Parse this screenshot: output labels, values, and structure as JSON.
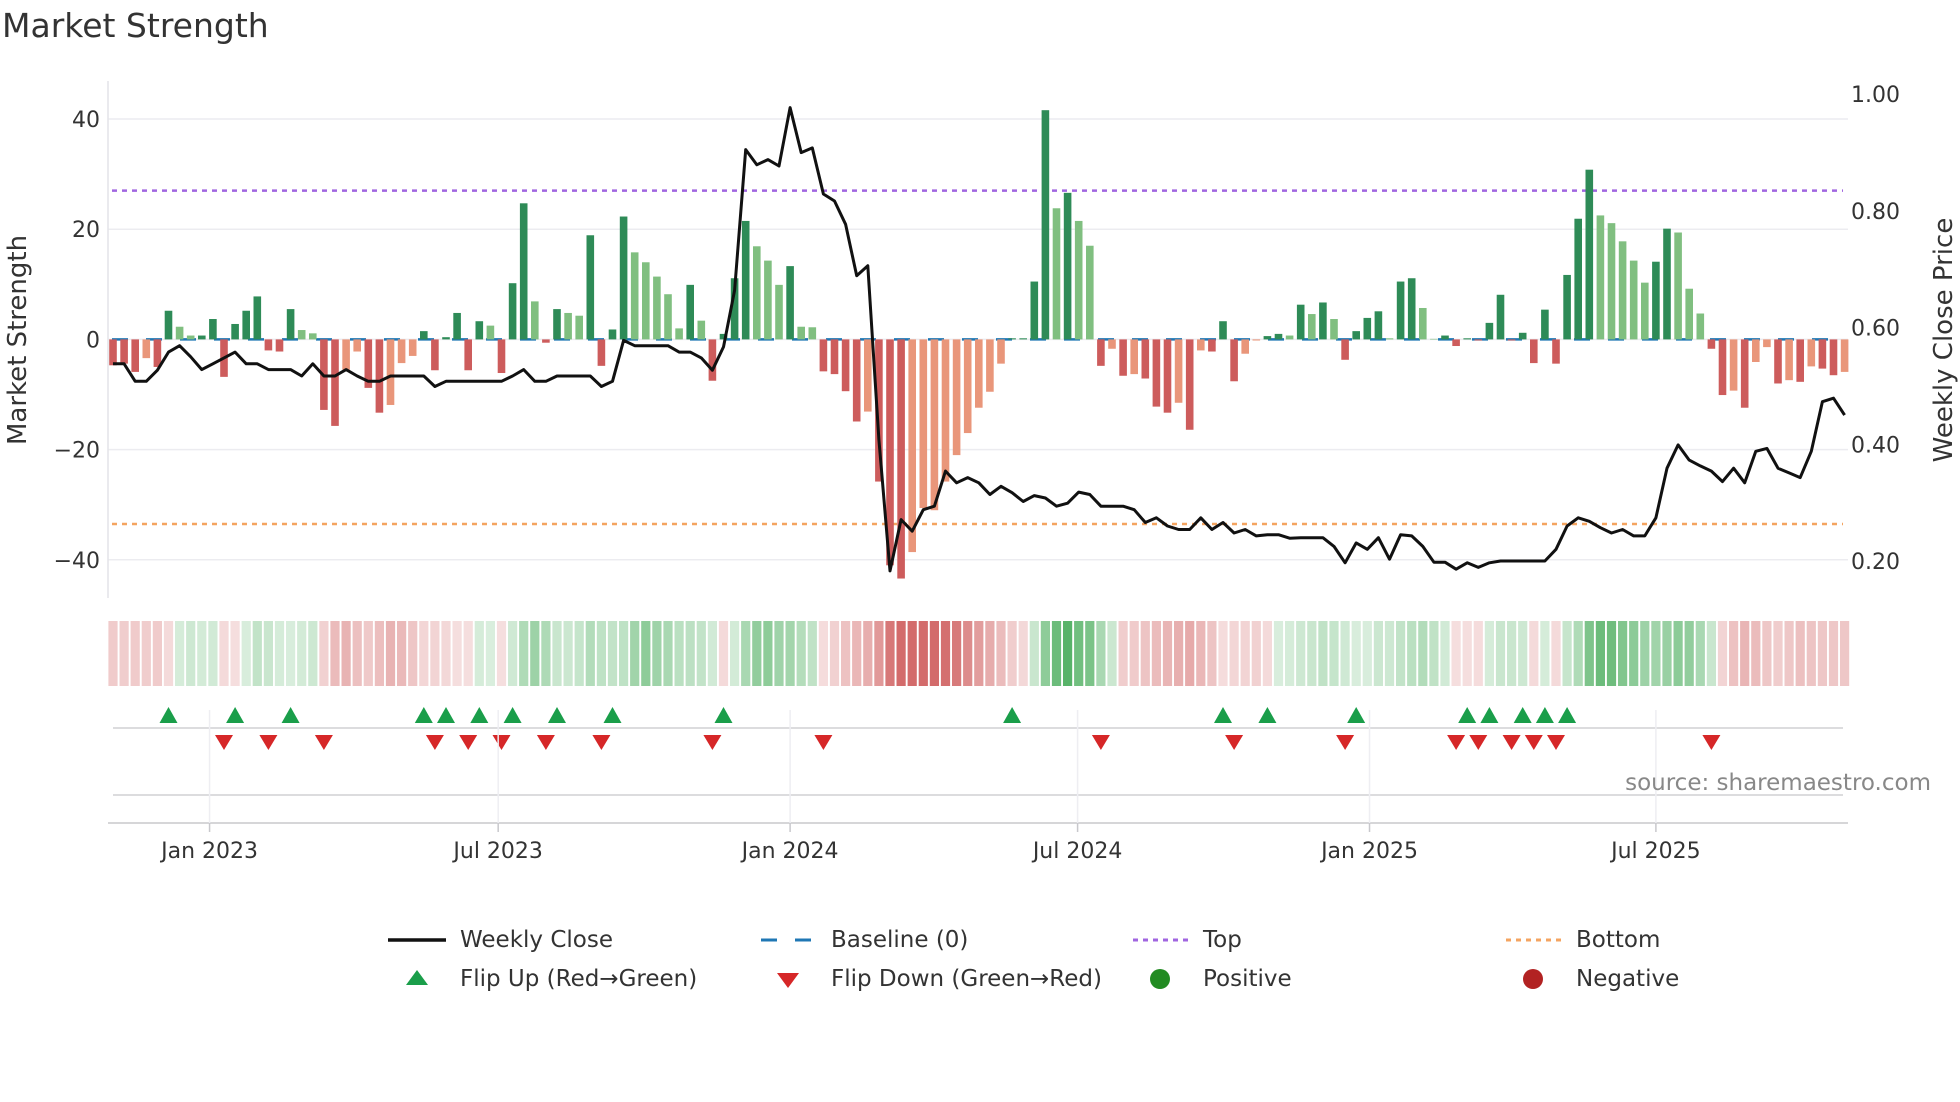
{
  "title": "Market Strength",
  "source": "source: sharemaestro.com",
  "colors": {
    "strong_positive": "#2e8b57",
    "weak_positive": "#80bf80",
    "strong_negative": "#cd5c5c",
    "weak_negative": "#e9967a",
    "price_line": "#111111",
    "baseline": "#1f77b4",
    "top": "#a066e0",
    "bottom": "#f4a460",
    "flip_up": "#1a9e4a",
    "flip_down": "#d62728",
    "positive": "#228b22",
    "negative": "#b22222"
  },
  "legend": [
    {
      "key": "weekly_close",
      "label": "Weekly Close"
    },
    {
      "key": "baseline",
      "label": "Baseline (0)"
    },
    {
      "key": "top",
      "label": "Top"
    },
    {
      "key": "bottom",
      "label": "Bottom"
    },
    {
      "key": "flip_up",
      "label": "Flip Up (Red→Green)"
    },
    {
      "key": "flip_down",
      "label": "Flip Down (Green→Red)"
    },
    {
      "key": "positive",
      "label": "Positive"
    },
    {
      "key": "negative",
      "label": "Negative"
    }
  ],
  "chart_data": {
    "type": "bar",
    "title": "Market Strength",
    "frequency": "weekly",
    "ylabel": "Market Strength",
    "ylabel_right": "Weekly Close Price",
    "ylim": [
      -47,
      49
    ],
    "ylim_right": [
      0.2,
      1.0
    ],
    "yticks": [
      {
        "v": 40,
        "label": "40"
      },
      {
        "v": 20,
        "label": "20"
      },
      {
        "v": 0,
        "label": "0"
      },
      {
        "v": -20,
        "label": "−20"
      },
      {
        "v": -40,
        "label": "−40"
      }
    ],
    "yticks_right": [
      {
        "v": 1.0,
        "label": "1.00"
      },
      {
        "v": 0.8,
        "label": "0.80"
      },
      {
        "v": 0.6,
        "label": "0.60"
      },
      {
        "v": 0.4,
        "label": "0.40"
      },
      {
        "v": 0.2,
        "label": "0.20"
      }
    ],
    "xticks": [
      {
        "week": 8.7,
        "label": "Jan 2023"
      },
      {
        "week": 34.7,
        "label": "Jul 2023"
      },
      {
        "week": 61.0,
        "label": "Jan 2024"
      },
      {
        "week": 86.9,
        "label": "Jul 2024"
      },
      {
        "week": 113.2,
        "label": "Jan 2025"
      },
      {
        "week": 139.0,
        "label": "Jul 2025"
      }
    ],
    "top_level": 27,
    "bottom_level": -33.5,
    "baseline": 0,
    "strength": [
      -4.7,
      -4.4,
      -5.9,
      -3.4,
      -5,
      5.2,
      2.3,
      0.7,
      0.7,
      3.7,
      -6.8,
      2.8,
      5.2,
      7.8,
      -2,
      -2.2,
      5.5,
      1.7,
      1.1,
      -12.8,
      -15.7,
      -5.5,
      -2.2,
      -8.8,
      -13.3,
      -11.9,
      -4.3,
      -3,
      1.5,
      -5.6,
      0.4,
      4.8,
      -5.6,
      3.3,
      2.5,
      -6.1,
      10.2,
      24.7,
      6.9,
      -0.6,
      5.5,
      4.8,
      4.3,
      18.9,
      -4.8,
      1.8,
      22.3,
      15.8,
      14,
      11.4,
      8.2,
      2,
      9.9,
      3.4,
      -7.5,
      1,
      11.1,
      21.5,
      16.9,
      14.3,
      9.9,
      13.3,
      2.3,
      2.2,
      -5.8,
      -6.3,
      -9.4,
      -14.9,
      -13.1,
      -25.8,
      -41,
      -43.4,
      -38.6,
      -30.6,
      -31,
      -25.8,
      -21,
      -17,
      -12.4,
      -9.5,
      -4.4,
      0.2,
      0.2,
      10.5,
      41.6,
      23.8,
      26.6,
      21.5,
      17,
      -4.8,
      -1.7,
      -6.6,
      -6.3,
      -7.1,
      -12.2,
      -13.3,
      -11.5,
      -16.4,
      -2,
      -2.2,
      3.3,
      -7.6,
      -2.6,
      -0.2,
      0.6,
      1,
      0.7,
      6.3,
      4.6,
      6.7,
      3.7,
      -3.7,
      1.5,
      3.9,
      5.1,
      0.2,
      10.5,
      11.1,
      5.7,
      0.1,
      0.7,
      -1.2,
      0.2,
      -0.2,
      3,
      8.1,
      -0.2,
      1.2,
      -4.3,
      5.4,
      -4.4,
      11.7,
      21.9,
      30.8,
      22.5,
      21.1,
      17.8,
      14.3,
      10.3,
      14.1,
      20.1,
      19.4,
      9.2,
      4.7,
      -1.7,
      -10.1,
      -9.3,
      -12.4,
      -4.1,
      -1.4,
      -8,
      -7.4,
      -7.7,
      -4.9,
      -5.3,
      -6.5,
      -5.9
    ],
    "shade": "RRRrRGggGGRGGGRRGggRRrrRRrrrGRGGRGgRGGgRGggGRGGgggggGgR",
    "shade2": "GGGgggGggRRRRrRRRrrrrrrrrrGGGGgGggRrRrRRRrRrRGRrrGGgGg",
    "shade3": "GgRGGGgGGggGRGRGGRGRGRGGGgggggGGgggRRrRrrRrRrRRr",
    "weekly_close": [
      0.538,
      0.538,
      0.508,
      0.508,
      0.527,
      0.558,
      0.569,
      0.55,
      0.528,
      0.538,
      0.548,
      0.558,
      0.538,
      0.538,
      0.528,
      0.528,
      0.528,
      0.517,
      0.538,
      0.517,
      0.517,
      0.528,
      0.517,
      0.508,
      0.508,
      0.517,
      0.517,
      0.517,
      0.517,
      0.499,
      0.508,
      0.508,
      0.508,
      0.508,
      0.508,
      0.508,
      0.517,
      0.528,
      0.508,
      0.508,
      0.517,
      0.517,
      0.517,
      0.517,
      0.499,
      0.508,
      0.578,
      0.569,
      0.569,
      0.569,
      0.569,
      0.558,
      0.558,
      0.548,
      0.527,
      0.567,
      0.664,
      0.905,
      0.879,
      0.888,
      0.877,
      0.977,
      0.9,
      0.908,
      0.829,
      0.817,
      0.777,
      0.689,
      0.706,
      0.408,
      0.183,
      0.271,
      0.251,
      0.288,
      0.294,
      0.354,
      0.334,
      0.343,
      0.334,
      0.314,
      0.328,
      0.317,
      0.302,
      0.312,
      0.308,
      0.294,
      0.299,
      0.318,
      0.314,
      0.294,
      0.294,
      0.294,
      0.288,
      0.266,
      0.274,
      0.26,
      0.254,
      0.254,
      0.274,
      0.254,
      0.266,
      0.248,
      0.254,
      0.243,
      0.245,
      0.245,
      0.239,
      0.24,
      0.24,
      0.24,
      0.225,
      0.197,
      0.231,
      0.22,
      0.24,
      0.203,
      0.245,
      0.243,
      0.225,
      0.198,
      0.198,
      0.186,
      0.197,
      0.189,
      0.197,
      0.2,
      0.2,
      0.2,
      0.2,
      0.2,
      0.22,
      0.26,
      0.274,
      0.268,
      0.257,
      0.248,
      0.254,
      0.243,
      0.243,
      0.274,
      0.359,
      0.399,
      0.373,
      0.363,
      0.354,
      0.336,
      0.359,
      0.334,
      0.388,
      0.393,
      0.359,
      0.351,
      0.343,
      0.388,
      0.473,
      0.479,
      0.45
    ],
    "flip_up_weeks": [
      5,
      11,
      16,
      28,
      30,
      33,
      36,
      40,
      45,
      55,
      81,
      100,
      104,
      112,
      122,
      124,
      127,
      129,
      131
    ],
    "flip_down_weeks": [
      10,
      14,
      19,
      29,
      32,
      35,
      39,
      44,
      54,
      64,
      89,
      101,
      111,
      121,
      123,
      126,
      128,
      130,
      144
    ],
    "legend_position": "bottom"
  }
}
